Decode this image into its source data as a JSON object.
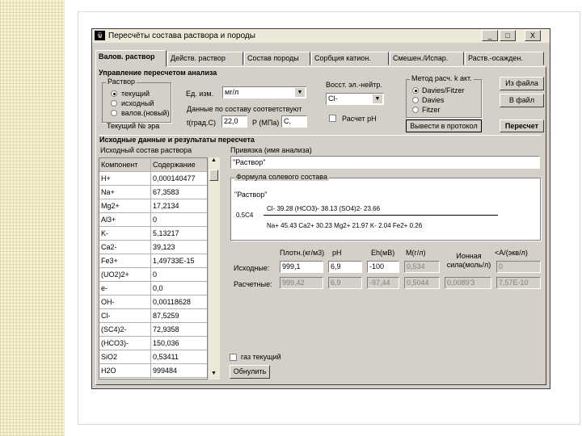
{
  "window": {
    "title": "Пересчёты состава раствора и породы",
    "controls": [
      "_",
      "□",
      "X"
    ]
  },
  "tabs": [
    {
      "label": "Валов. раствор",
      "active": true
    },
    {
      "label": "Действ. раствор",
      "active": false
    },
    {
      "label": "Состав породы",
      "active": false
    },
    {
      "label": "Сорбция катион.",
      "active": false
    },
    {
      "label": "Смешен./Испар.",
      "active": false
    },
    {
      "label": "Раств.-осажден.",
      "active": false
    }
  ],
  "control_section": {
    "heading": "Управление пересчетом анализа",
    "solution_group": {
      "label": "Раствор",
      "options": [
        "текущий",
        "исходный",
        "валов.(новый)"
      ],
      "selected_index": 0
    },
    "current_label": "Текущий № эра",
    "units": {
      "label": "Ед. изм.",
      "value": "мг/л"
    },
    "composition_label": "Данные по составу соответствуют",
    "temperature": {
      "label": "t(град.С)",
      "value": "22,0"
    },
    "pressure": {
      "label": "P (МПа)",
      "value": "C,"
    },
    "redox": {
      "label": "Восст. эл.-нейтр.",
      "value": "Cl-"
    },
    "calc_ph": {
      "label": "Расчет pH",
      "checked": false
    },
    "method_group": {
      "label": "Метод расч. k акт.",
      "options": [
        "Davies/Fitzer",
        "Davies",
        "Fitzer"
      ],
      "selected_index": 0
    },
    "buttons": {
      "from_file": "Из файла",
      "to_file": "В файл",
      "to_protocol": "Вывести в протокол",
      "recalc": "Пересчет"
    }
  },
  "results_section": {
    "heading": "Исходные данные и результаты пересчета",
    "composition_label": "Исходный состав раствора",
    "grid_headers": [
      "Компонент",
      "Содержание"
    ],
    "rows": [
      [
        "H+",
        "0,000140477"
      ],
      [
        "Na+",
        "67,3583"
      ],
      [
        "Mg2+",
        "17,2134"
      ],
      [
        "Al3+",
        "0"
      ],
      [
        "K-",
        "5,13217"
      ],
      [
        "Ca2-",
        "39,123"
      ],
      [
        "Fe3+",
        "1,49733E-15"
      ],
      [
        "(UO2)2+",
        "0"
      ],
      [
        "e-",
        "0,0"
      ],
      [
        "OH-",
        "0,00118628"
      ],
      [
        "Cl-",
        "87,5259"
      ],
      [
        "(SC4)2-",
        "72,9358"
      ],
      [
        "(HCO3)-",
        "150,036"
      ],
      [
        "SiO2",
        "0,53411"
      ],
      [
        "H2O",
        "999484"
      ]
    ],
    "binding": {
      "label": "Привязка (имя анализа)",
      "value": "\"Раствор\""
    },
    "salt_formula": {
      "label": "Формула солевого состава",
      "name": "\"Раствор\"",
      "anions": "Cl-  39.28 (HCO3)-  38.13 (SO4)2-  23.66",
      "ratio": "0.5С4",
      "cations": "Na+  45.43 Ca2+  30.23 Mg2+  21.97 K-   2.04 Fe2+  0.26"
    },
    "params_headers": [
      "Плотн.(кг/м3)",
      "pH",
      "Eh(мВ)",
      "M(г/л)",
      "Ионная сила(моль/л)",
      "<A/(экв/л)"
    ],
    "initial": {
      "label": "Исходные:",
      "values": [
        "999,1",
        "6,9",
        "-100",
        "0,534",
        "",
        "0"
      ]
    },
    "calculated": {
      "label": "Расчетные:",
      "values": [
        "999,42",
        "6,9",
        "-97,44",
        "0,5044",
        "0,0089'3",
        "7,57E-10"
      ]
    },
    "gas_current": {
      "label": "газ текущий",
      "checked": false
    },
    "reset_button": "Обнулить"
  }
}
